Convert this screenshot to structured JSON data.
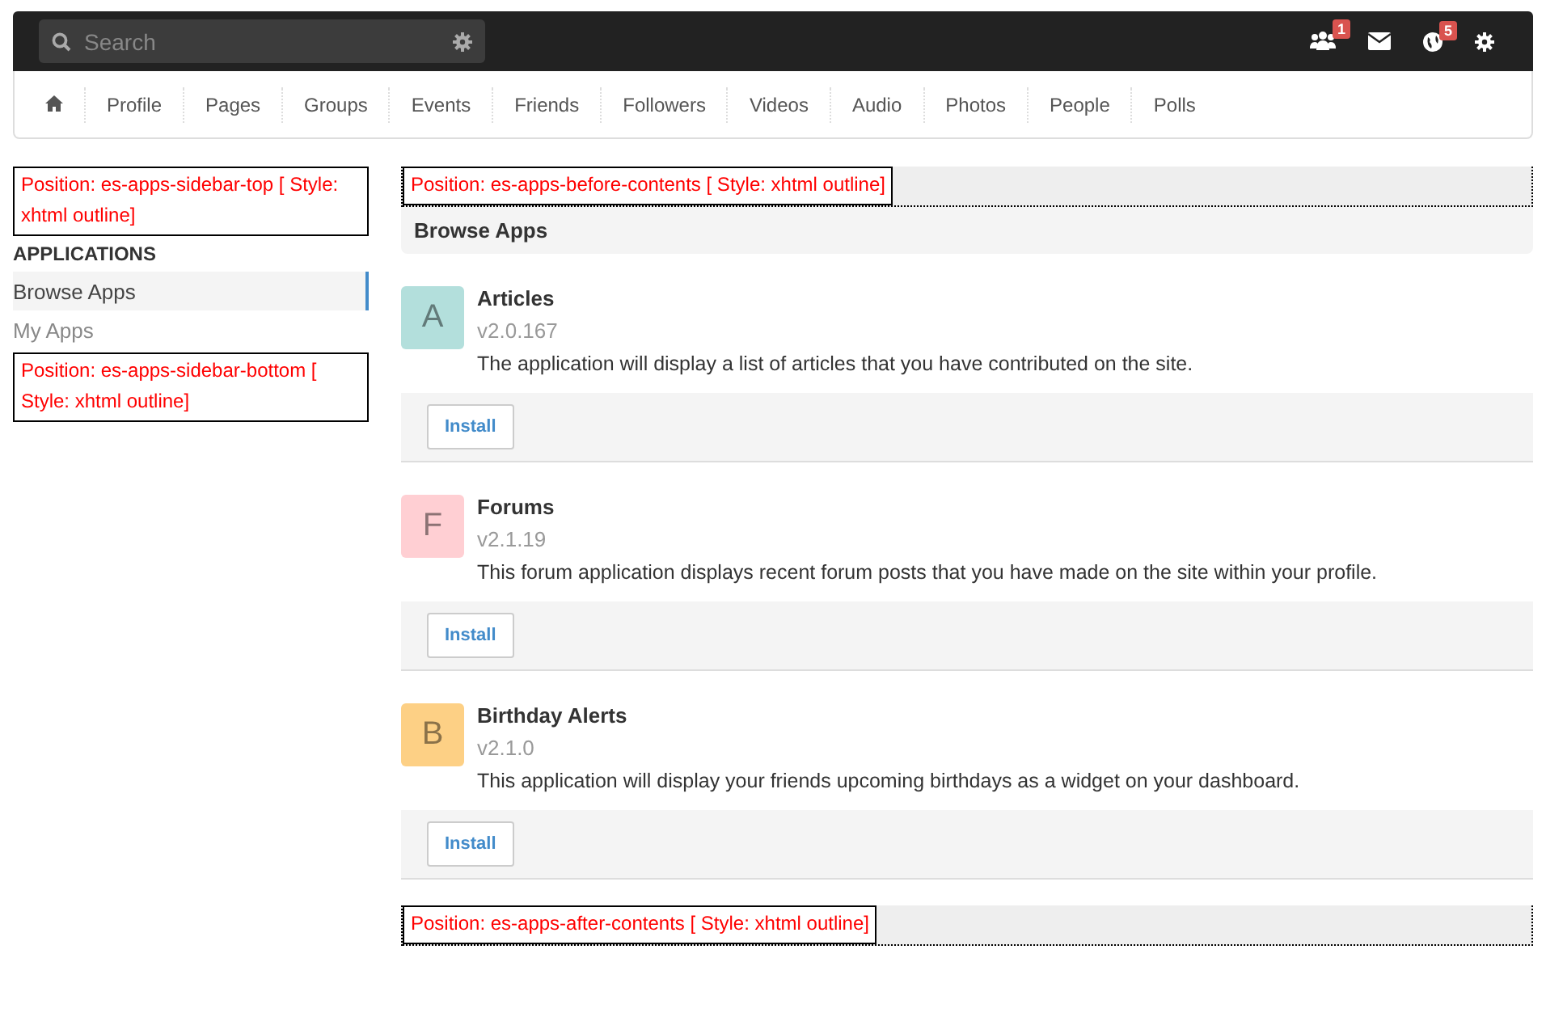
{
  "toolbar": {
    "search": {
      "placeholder": "Search"
    },
    "notifications": [
      {
        "kind": "friends",
        "badge": "1"
      },
      {
        "kind": "mail"
      },
      {
        "kind": "globe",
        "badge": "5"
      },
      {
        "kind": "settings"
      }
    ]
  },
  "nav": {
    "items": [
      "Profile",
      "Pages",
      "Groups",
      "Events",
      "Friends",
      "Followers",
      "Videos",
      "Audio",
      "Photos",
      "People",
      "Polls"
    ]
  },
  "sidebar": {
    "top_module": "Position: es-apps-sidebar-top [ Style: xhtml outline]",
    "heading": "APPLICATIONS",
    "items": [
      {
        "label": "Browse Apps",
        "selected": true
      },
      {
        "label": "My Apps",
        "selected": false
      }
    ],
    "bottom_module": "Position: es-apps-sidebar-bottom [ Style: xhtml outline]"
  },
  "content": {
    "before_module": "Position: es-apps-before-contents [ Style: xhtml outline]",
    "title": "Browse Apps",
    "apps": [
      {
        "letter": "A",
        "color": "#b3dfdc",
        "name": "Articles",
        "version": "v2.0.167",
        "description": "The application will display a list of articles that you have contributed on the site.",
        "button": "Install"
      },
      {
        "letter": "F",
        "color": "#ffcfd3",
        "name": "Forums",
        "version": "v2.1.19",
        "description": "This forum application displays recent forum posts that you have made on the site within your profile.",
        "button": "Install"
      },
      {
        "letter": "B",
        "color": "#fdd085",
        "name": "Birthday Alerts",
        "version": "v2.1.0",
        "description": "This application will display your friends upcoming birthdays as a widget on your dashboard.",
        "button": "Install"
      }
    ],
    "after_module": "Position: es-apps-after-contents [ Style: xhtml outline]"
  }
}
